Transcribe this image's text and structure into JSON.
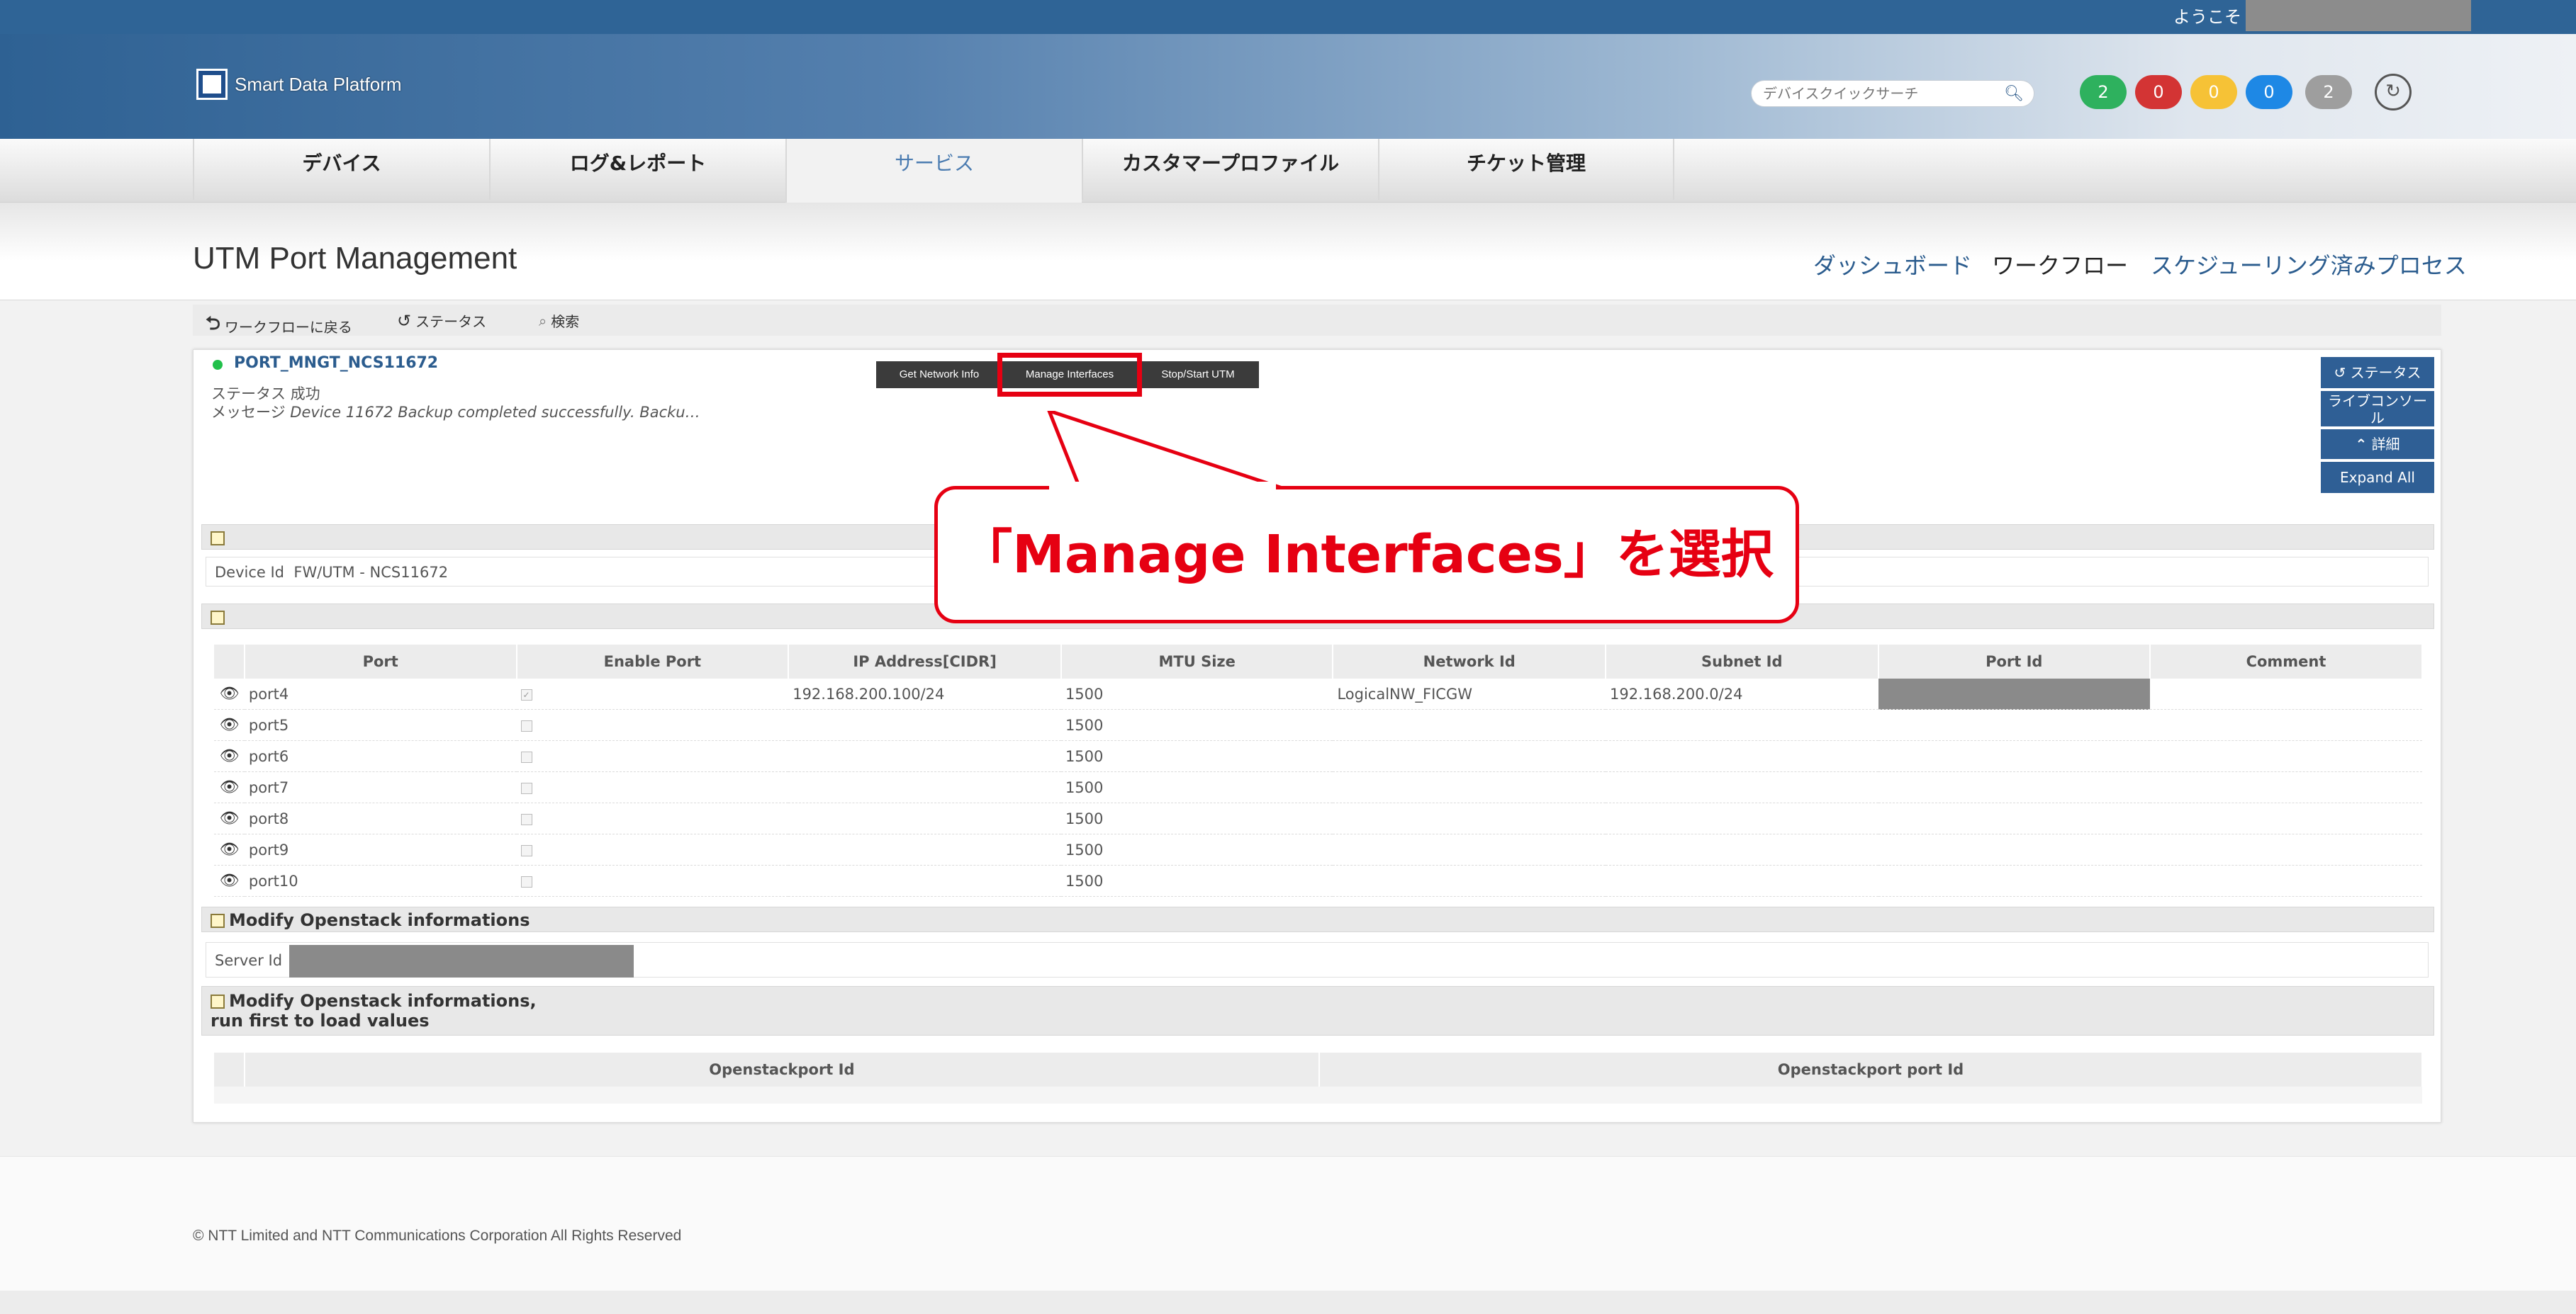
{
  "header": {
    "welcome": "ようこそ",
    "logo_text": "Smart Data Platform",
    "search_placeholder": "デバイスクイックサーチ",
    "badges": [
      {
        "value": "2",
        "color": "#2eb15e"
      },
      {
        "value": "0",
        "color": "#d33434"
      },
      {
        "value": "0",
        "color": "#f6c236"
      },
      {
        "value": "0",
        "color": "#1e88e5"
      },
      {
        "value": "2",
        "color": "#9e9e9e"
      }
    ]
  },
  "nav": {
    "tabs": [
      "デバイス",
      "ログ&レポート",
      "サービス",
      "カスタマープロファイル",
      "チケット管理"
    ],
    "active": "サービス"
  },
  "page": {
    "title": "UTM Port Management",
    "links": [
      "ダッシュボード",
      "ワークフロー",
      "スケジューリング済みプロセス"
    ]
  },
  "toolbar": {
    "back": "ワークフローに戻る",
    "status": "ステータス",
    "search": "検索"
  },
  "instance": {
    "name": "PORT_MNGT_NCS11672",
    "status_label": "ステータス",
    "status_value": "成功",
    "message_label": "メッセージ",
    "message_value": "Device 11672 Backup completed successfully. Backu…"
  },
  "actions": [
    "Get Network Info",
    "Manage Interfaces",
    "Stop/Start UTM"
  ],
  "side_buttons": {
    "status": "ステータス",
    "console": "ライブコンソール",
    "detail": "詳細",
    "expand": "Expand All"
  },
  "callout": "「Manage Interfaces」を選択",
  "device": {
    "label": "Device Id",
    "value": "FW/UTM - NCS11672"
  },
  "ports": {
    "columns": [
      "Port",
      "Enable Port",
      "IP Address[CIDR]",
      "MTU Size",
      "Network Id",
      "Subnet Id",
      "Port Id",
      "Comment"
    ],
    "rows": [
      {
        "port": "port4",
        "ip": "192.168.200.100/24",
        "mtu": "1500",
        "network": "LogicalNW_FICGW",
        "subnet": "192.168.200.0/24",
        "enabled": true
      },
      {
        "port": "port5",
        "ip": "",
        "mtu": "1500",
        "network": "",
        "subnet": "",
        "enabled": false
      },
      {
        "port": "port6",
        "ip": "",
        "mtu": "1500",
        "network": "",
        "subnet": "",
        "enabled": false
      },
      {
        "port": "port7",
        "ip": "",
        "mtu": "1500",
        "network": "",
        "subnet": "",
        "enabled": false
      },
      {
        "port": "port8",
        "ip": "",
        "mtu": "1500",
        "network": "",
        "subnet": "",
        "enabled": false
      },
      {
        "port": "port9",
        "ip": "",
        "mtu": "1500",
        "network": "",
        "subnet": "",
        "enabled": false
      },
      {
        "port": "port10",
        "ip": "",
        "mtu": "1500",
        "network": "",
        "subnet": "",
        "enabled": false
      }
    ]
  },
  "openstack": {
    "section1": "Modify Openstack informations",
    "server_label": "Server Id",
    "section2_line1": "Modify Openstack informations,",
    "section2_line2": "run first to load values",
    "columns": [
      "Openstackport Id",
      "Openstackport port Id"
    ]
  },
  "footer": {
    "copyright": "© NTT Limited and NTT Communications Corporation All Rights Reserved"
  }
}
